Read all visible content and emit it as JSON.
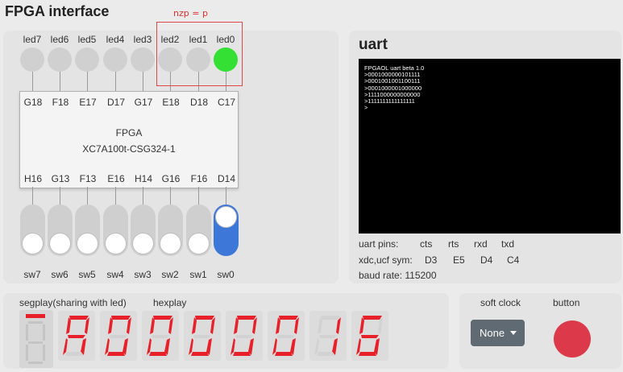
{
  "app": {
    "title": "FPGA interface",
    "annotation": "nzp = p"
  },
  "leds": [
    {
      "label": "led7",
      "pin": "G18",
      "on": false
    },
    {
      "label": "led6",
      "pin": "F18",
      "on": false
    },
    {
      "label": "led5",
      "pin": "E17",
      "on": false
    },
    {
      "label": "led4",
      "pin": "D17",
      "on": false
    },
    {
      "label": "led3",
      "pin": "G17",
      "on": false
    },
    {
      "label": "led2",
      "pin": "E18",
      "on": false
    },
    {
      "label": "led1",
      "pin": "D18",
      "on": false
    },
    {
      "label": "led0",
      "pin": "C17",
      "on": true
    }
  ],
  "chip": {
    "name": "FPGA",
    "model": "XC7A100t-CSG324-1"
  },
  "switches": [
    {
      "label": "sw7",
      "pin": "H16",
      "on": false
    },
    {
      "label": "sw6",
      "pin": "G13",
      "on": false
    },
    {
      "label": "sw5",
      "pin": "F13",
      "on": false
    },
    {
      "label": "sw4",
      "pin": "E16",
      "on": false
    },
    {
      "label": "sw3",
      "pin": "H14",
      "on": false
    },
    {
      "label": "sw2",
      "pin": "G16",
      "on": false
    },
    {
      "label": "sw1",
      "pin": "F16",
      "on": false
    },
    {
      "label": "sw0",
      "pin": "D14",
      "on": true
    }
  ],
  "uart": {
    "title": "uart",
    "terminal": [
      "FPGAOL uart beta 1.0",
      ">0001000000101111",
      ">0001001001100111",
      ">0001000001000000",
      ">1111000000000000",
      ">1111111111111111",
      ">"
    ],
    "pins_label": "uart pins:",
    "pin_names": [
      "cts",
      "rts",
      "rxd",
      "txd"
    ],
    "sym_label": "xdc,ucf sym:",
    "syms": [
      "D3",
      "E5",
      "D4",
      "C4"
    ],
    "baud": "baud rate: 115200"
  },
  "segplay": {
    "title": "segplay(sharing with led)",
    "hexplay_label": "hexplay",
    "digits": [
      "A",
      "0",
      "0",
      "0",
      "0",
      "0",
      "1",
      "6"
    ]
  },
  "controls": {
    "soft_clock_label": "soft clock",
    "soft_clock_value": "None",
    "button_label": "button",
    "button_color": "#dc3a4a"
  },
  "colors": {
    "led_on": "#33e033",
    "switch_on": "#3d78d8",
    "segment_on": "#e8202a",
    "highlight": "#e04848"
  }
}
